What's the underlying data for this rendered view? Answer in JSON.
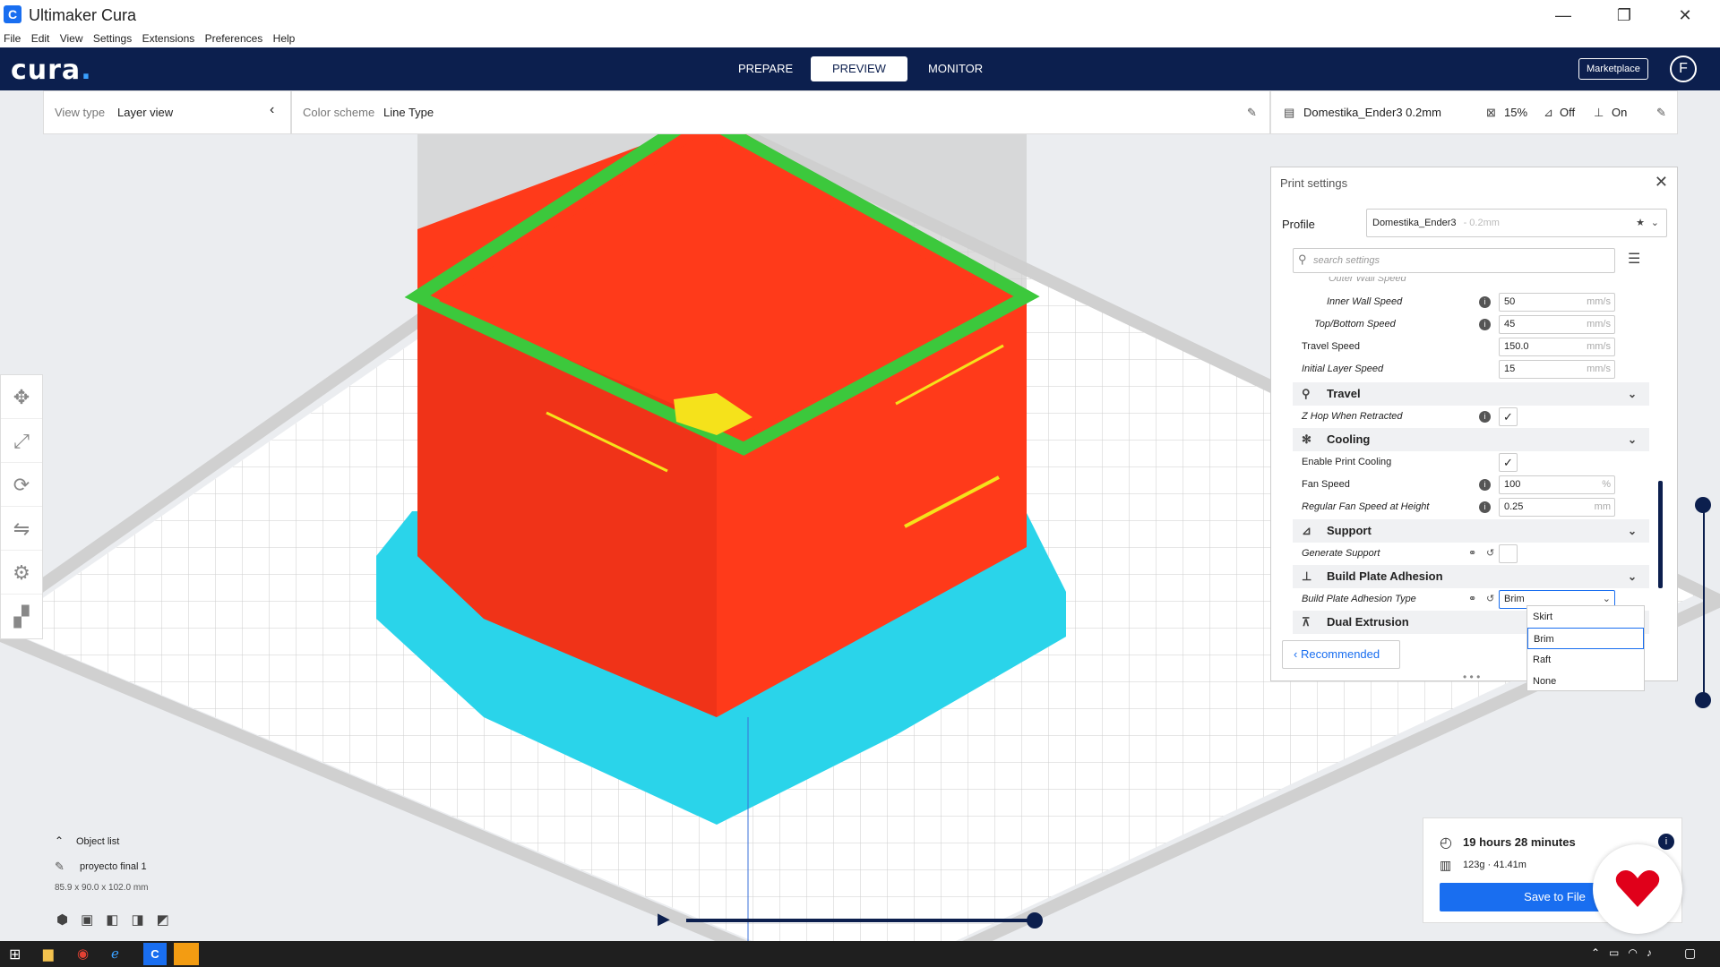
{
  "window": {
    "title": "Ultimaker Cura",
    "app_icon": "C"
  },
  "window_controls": {
    "minimize": "—",
    "maximize": "❐",
    "close": "✕"
  },
  "menu": [
    "File",
    "Edit",
    "View",
    "Settings",
    "Extensions",
    "Preferences",
    "Help"
  ],
  "header": {
    "logo": "cura",
    "logo_dot": ".",
    "tabs": [
      "PREPARE",
      "PREVIEW",
      "MONITOR"
    ],
    "active_tab": "PREVIEW",
    "marketplace": "Marketplace",
    "account_initial": "F"
  },
  "view_bar": {
    "view_type_label": "View type",
    "view_type_value": "Layer view",
    "color_scheme_label": "Color scheme",
    "color_scheme_value": "Line Type",
    "printer_profile": "Domestika_Ender3 0.2mm",
    "infill": "15%",
    "support": "Off",
    "adhesion": "On"
  },
  "print_settings": {
    "title": "Print settings",
    "profile_label": "Profile",
    "profile_name": "Domestika_Ender3",
    "profile_sub": "- 0.2mm",
    "search_placeholder": "search settings",
    "partial_row": "Outer Wall Speed",
    "rows": [
      {
        "name": "Inner Wall Speed",
        "value": "50",
        "unit": "mm/s",
        "indent": 2,
        "info": true
      },
      {
        "name": "Top/Bottom Speed",
        "value": "45",
        "unit": "mm/s",
        "indent": 1,
        "info": true
      },
      {
        "name": "Travel Speed",
        "value": "150.0",
        "unit": "mm/s",
        "indent": 0,
        "info": false
      },
      {
        "name": "Initial Layer Speed",
        "value": "15",
        "unit": "mm/s",
        "indent": 0,
        "info": false
      }
    ],
    "travel_category": "Travel",
    "z_hop": {
      "name": "Z Hop When Retracted",
      "checked": true
    },
    "cooling_category": "Cooling",
    "enable_cooling": {
      "name": "Enable Print Cooling",
      "checked": true
    },
    "fan_speed": {
      "name": "Fan Speed",
      "value": "100",
      "unit": "%"
    },
    "fan_height": {
      "name": "Regular Fan Speed at Height",
      "value": "0.25",
      "unit": "mm"
    },
    "support_category": "Support",
    "generate_support": {
      "name": "Generate Support",
      "checked": false
    },
    "adhesion_category": "Build Plate Adhesion",
    "adhesion_type": {
      "name": "Build Plate Adhesion Type",
      "value": "Brim"
    },
    "dual_category": "Dual Extrusion",
    "recommended": "Recommended",
    "dropdown_options": [
      "Skirt",
      "Brim",
      "Raft",
      "None"
    ],
    "dropdown_highlight": "Brim"
  },
  "object_list": {
    "label": "Object list",
    "object_name": "proyecto final 1",
    "dimensions": "85.9 x 90.0 x 102.0 mm"
  },
  "job": {
    "time": "19 hours 28 minutes",
    "material": "123g · 41.41m",
    "save_button": "Save to File"
  },
  "layer_slider": {
    "top_fraction": 0.0,
    "bottom_fraction": 1.0
  },
  "playback": {
    "progress": 1.0
  },
  "colors": {
    "header": "#0c1f4e",
    "accent": "#196ef0",
    "wall": "#ff3a1a",
    "skin": "#f5e21b",
    "inner_wall": "#3cc83c",
    "brim": "#2ad4ea",
    "build_plate": "#ffffff"
  }
}
